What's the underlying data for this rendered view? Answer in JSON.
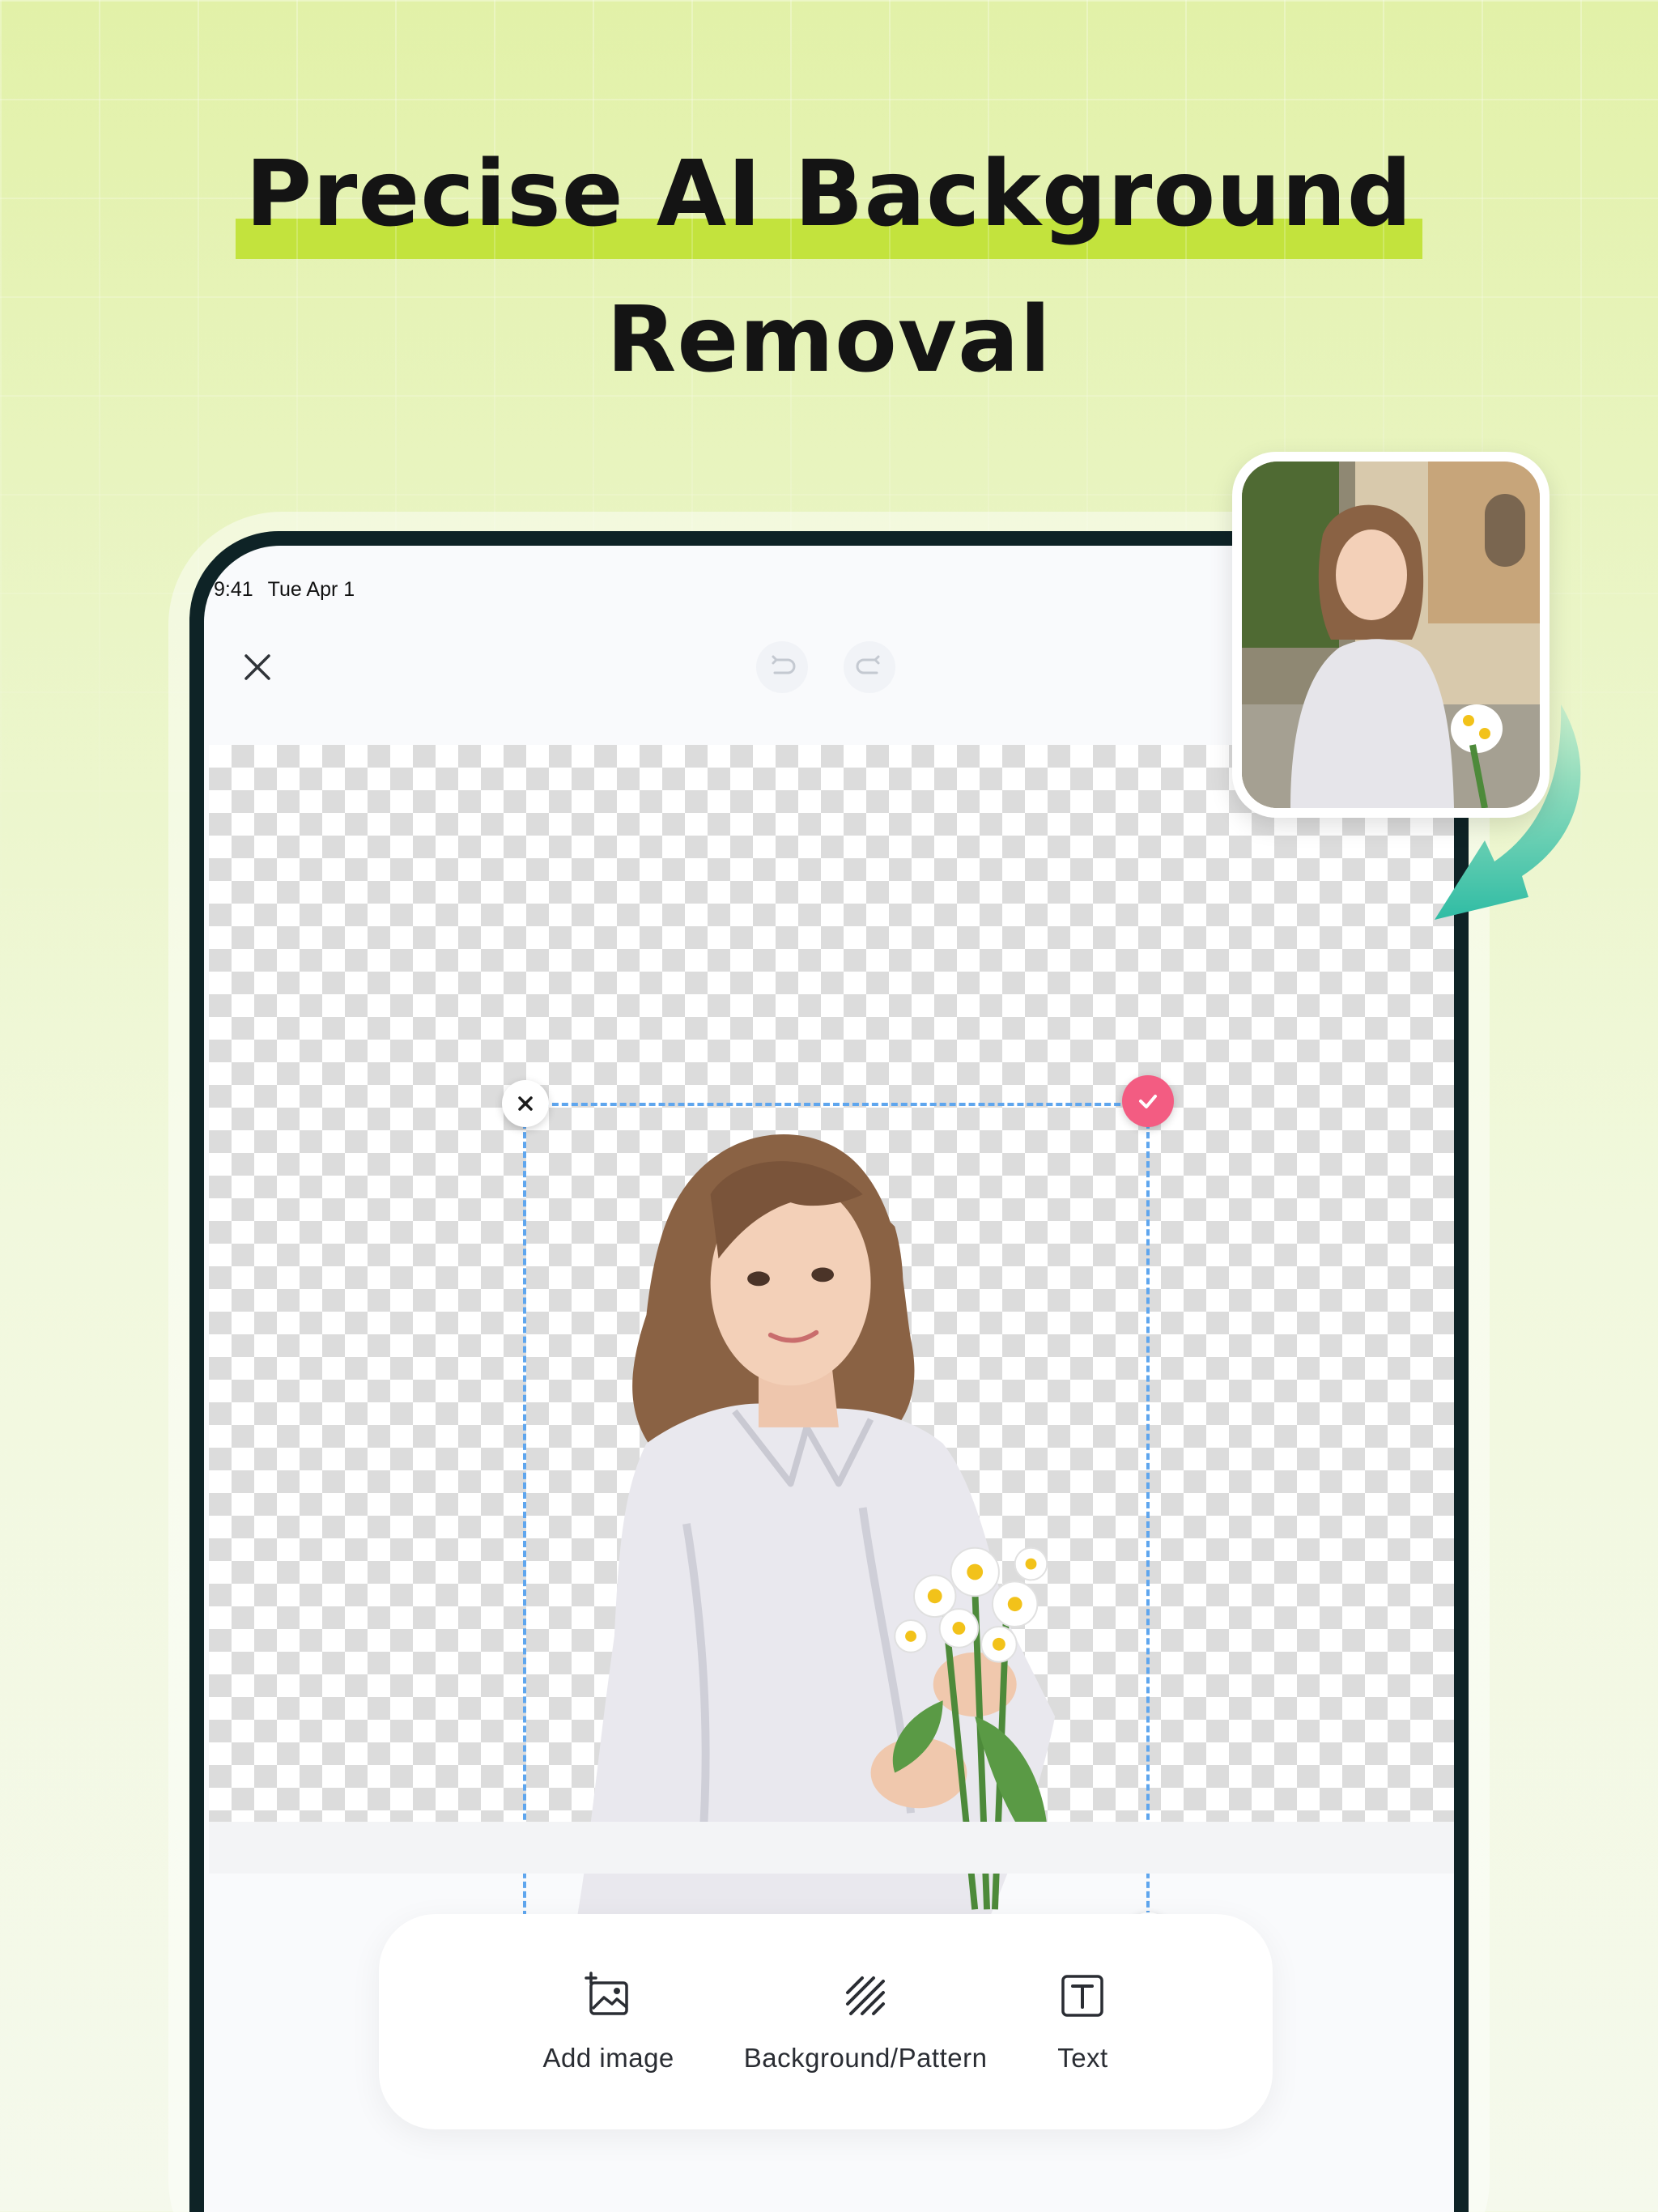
{
  "headline": {
    "line1": "Precise AI Background",
    "line2": "Removal"
  },
  "status_bar": {
    "time": "9:41",
    "date": "Tue Apr 1"
  },
  "top_bar": {
    "close_icon": "close-icon",
    "undo_icon": "undo-icon",
    "redo_icon": "redo-icon"
  },
  "selection_handles": {
    "delete_icon": "close-icon",
    "confirm_icon": "check-icon",
    "rotate_icon": "rotate-icon"
  },
  "toolbar": {
    "items": [
      {
        "label": "Add image",
        "icon": "add-image-icon"
      },
      {
        "label": "Background/Pattern",
        "icon": "pattern-icon"
      },
      {
        "label": "Text",
        "icon": "text-icon"
      }
    ]
  },
  "colors": {
    "accent_highlight": "#c3e33d",
    "confirm_pink": "#f35c82",
    "selection_blue": "#5fa6ee",
    "arrow_teal": "#3cc2a8",
    "device_frame": "#0e2326"
  }
}
